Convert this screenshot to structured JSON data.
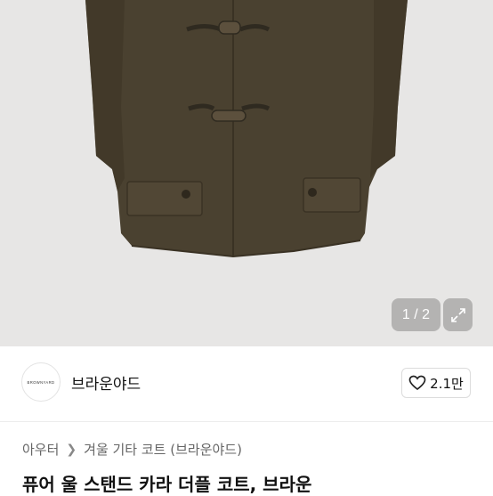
{
  "gallery": {
    "counter": "1 / 2",
    "background": "#e7e6e5",
    "coat_color": "#4a4130"
  },
  "seller": {
    "avatar_text": "BROWNYARD",
    "name": "브라운야드",
    "like_count": "2.1만"
  },
  "breadcrumb": {
    "items": [
      "아우터",
      "겨울 기타 코트 (브라운야드)"
    ]
  },
  "product": {
    "title": "퓨어 울 스탠드 카라 더플 코트, 브라운"
  }
}
